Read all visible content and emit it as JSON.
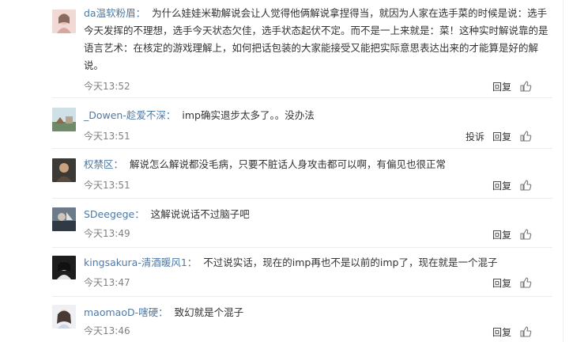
{
  "comments": [
    {
      "user": "da温软粉眉：",
      "text": "为什么娃娃米勒解说会让人觉得他俩解说拿捏得当，就因为人家在选手菜的时候是说：选手今天发挥的不理想，选手今天状态欠佳，选手状态起伏不定。而不是一上来就是：菜！这种实时解说靠的是语言艺术：在核定的游戏理解上，如何把话包装的大家能接受又能把实际意思表达出来的才能算是好的解说。",
      "time": "今天13:52",
      "reply": "回复"
    },
    {
      "user": "_Dowen-趁爱不深：",
      "text": "imp确实退步太多了。。没办法",
      "time": "今天13:51",
      "report": "投诉",
      "reply": "回复"
    },
    {
      "user": "权禁区：",
      "text": "解说怎么解说都没毛病，只要不脏话人身攻击都可以啊，有偏见也很正常",
      "time": "今天13:51",
      "reply": "回复"
    },
    {
      "user": "SDeegege：",
      "text": "这解说说话不过脑子吧",
      "time": "今天13:49",
      "reply": "回复"
    },
    {
      "user": "kingsakura-清酒暖风1：",
      "text": "不过说实话，现在的imp再也不是以前的imp了，现在就是一个混子",
      "time": "今天13:47",
      "reply": "回复"
    },
    {
      "user": "maomaoD-嗐硬：",
      "text": "致幻就是个混子",
      "time": "今天13:46",
      "reply": "回复"
    }
  ],
  "colors": {
    "username": "#4d79a6",
    "meta": "#808080",
    "divider": "#ededed"
  },
  "icons": [
    "thumbs-up-icon"
  ]
}
